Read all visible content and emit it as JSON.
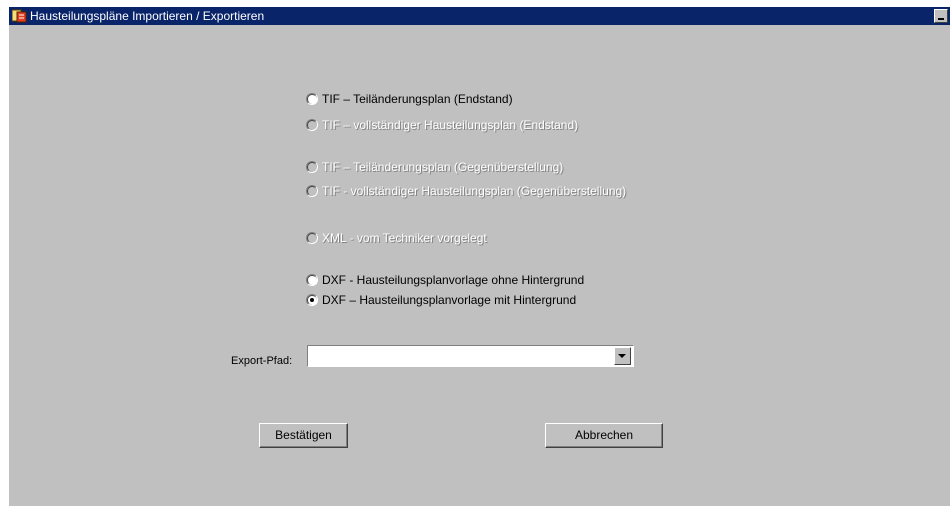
{
  "window": {
    "title": "Hausteilungspläne Importieren / Exportieren",
    "app_icon": "app-icon",
    "minimize_icon": "minimize-icon"
  },
  "options": [
    {
      "id": "tif-teilaenderung-endstand",
      "label": "TIF – Teiländerungsplan (Endstand)",
      "enabled": true,
      "checked": false
    },
    {
      "id": "tif-vollstaendig-endstand",
      "label": "TIF – vollständiger Hausteilungsplan (Endstand)",
      "enabled": false,
      "checked": false
    },
    {
      "id": "tif-teilaenderung-gegenueberstellung",
      "label": "TIF – Teiländerungsplan (Gegenüberstellung)",
      "enabled": false,
      "checked": false
    },
    {
      "id": "tif-vollstaendig-gegenueberstellung",
      "label": "TIF - vollständiger Hausteilungsplan (Gegenüberstellung)",
      "enabled": false,
      "checked": false
    },
    {
      "id": "xml-techniker",
      "label": "XML - vom Techniker vorgelegt",
      "enabled": false,
      "checked": false
    },
    {
      "id": "dxf-ohne-hintergrund",
      "label": "DXF - Hausteilungsplanvorlage ohne Hintergrund",
      "enabled": true,
      "checked": false
    },
    {
      "id": "dxf-mit-hintergrund",
      "label": "DXF – Hausteilungsplanvorlage mit Hintergrund",
      "enabled": true,
      "checked": true
    }
  ],
  "export": {
    "label": "Export-Pfad:",
    "value": "",
    "dropdown_icon": "chevron-down-icon"
  },
  "buttons": {
    "confirm": "Bestätigen",
    "cancel": "Abbrechen"
  }
}
